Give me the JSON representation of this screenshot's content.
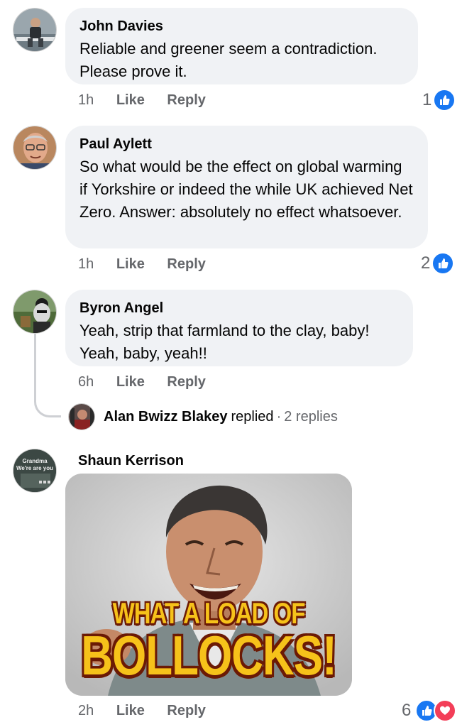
{
  "colors": {
    "bubble": "#f0f2f5",
    "meta_text": "#65676b",
    "like_blue": "#1877f2",
    "love_red": "#f33e58",
    "meme_text": "#f6c21a"
  },
  "comments": [
    {
      "author": "John Davies",
      "text": "Reliable and greener seem a contradiction. Please prove it.",
      "time": "1h",
      "like_label": "Like",
      "reply_label": "Reply",
      "reaction_count": "1",
      "reactions": [
        "like-icon"
      ]
    },
    {
      "author": "Paul Aylett",
      "text": "So what would be the effect on global warming  if Yorkshire or indeed the while UK achieved Net Zero. Answer: absolutely no effect whatsoever.",
      "time": "1h",
      "like_label": "Like",
      "reply_label": "Reply",
      "reaction_count": "2",
      "reactions": [
        "like-icon"
      ]
    },
    {
      "author": "Byron Angel",
      "text": "Yeah, strip that farmland to the clay, baby! Yeah, baby, yeah!!",
      "time": "6h",
      "like_label": "Like",
      "reply_label": "Reply",
      "replies_summary": {
        "author": "Alan Bwizz Blakey",
        "action": "replied",
        "separator": "·",
        "count_text": "2 replies"
      }
    },
    {
      "author": "Shaun Kerrison",
      "avatar_text": [
        "Grandma",
        "We're are you"
      ],
      "meme_text": [
        "WHAT A LOAD OF",
        "BOLLOCKS!"
      ],
      "time": "2h",
      "like_label": "Like",
      "reply_label": "Reply",
      "reaction_count": "6",
      "reactions": [
        "like-icon",
        "love-icon"
      ]
    }
  ]
}
